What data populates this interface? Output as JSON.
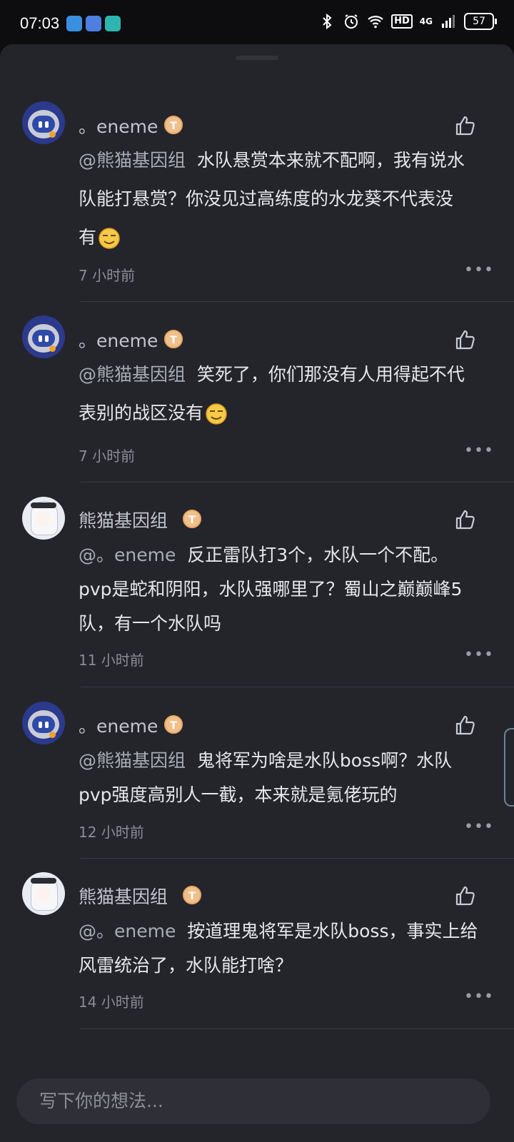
{
  "status_bar": {
    "time": "07:03",
    "battery": "57",
    "network": "4G",
    "hd": "HD"
  },
  "comments": [
    {
      "username": "。eneme",
      "badge": "T",
      "mention": "@熊猫基因组",
      "lines": [
        "水队悬赏本来就不配啊，我有说水",
        "队能打悬赏？你没见过高练度的水龙葵不代表没",
        "有"
      ],
      "has_emoji": true,
      "time": "7 小时前"
    },
    {
      "username": "。eneme",
      "badge": "T",
      "mention": "@熊猫基因组",
      "lines": [
        "笑死了，你们那没有人用得起不代",
        "表别的战区没有"
      ],
      "has_emoji": true,
      "time": "7 小时前"
    },
    {
      "username": "熊猫基因组",
      "badge": "T",
      "mention": "@。eneme",
      "lines": [
        "反正雷队打3个，水队一个不配。",
        "pvp是蛇和阴阳，水队强哪里了？蜀山之巅巅峰5",
        "队，有一个水队吗"
      ],
      "has_emoji": false,
      "time": "11 小时前"
    },
    {
      "username": "。eneme",
      "badge": "T",
      "mention": "@熊猫基因组",
      "lines": [
        "鬼将军为啥是水队boss啊？水队",
        "pvp强度高别人一截，本来就是氪佬玩的"
      ],
      "has_emoji": false,
      "time": "12 小时前"
    },
    {
      "username": "熊猫基因组",
      "badge": "T",
      "mention": "@。eneme",
      "lines": [
        "按道理鬼将军是水队boss，事实上给",
        "风雷统治了，水队能打啥？"
      ],
      "has_emoji": false,
      "time": "14 小时前"
    }
  ],
  "input": {
    "placeholder": "写下你的想法..."
  },
  "icons": {
    "like": "thumbs-up-icon",
    "more": "more-dots-icon",
    "emoji": "smug-face-emoji"
  },
  "colors": {
    "background": "#24252b",
    "text": "#e6e7ec",
    "muted": "#8b8d96",
    "badge": "#f0c08c"
  }
}
